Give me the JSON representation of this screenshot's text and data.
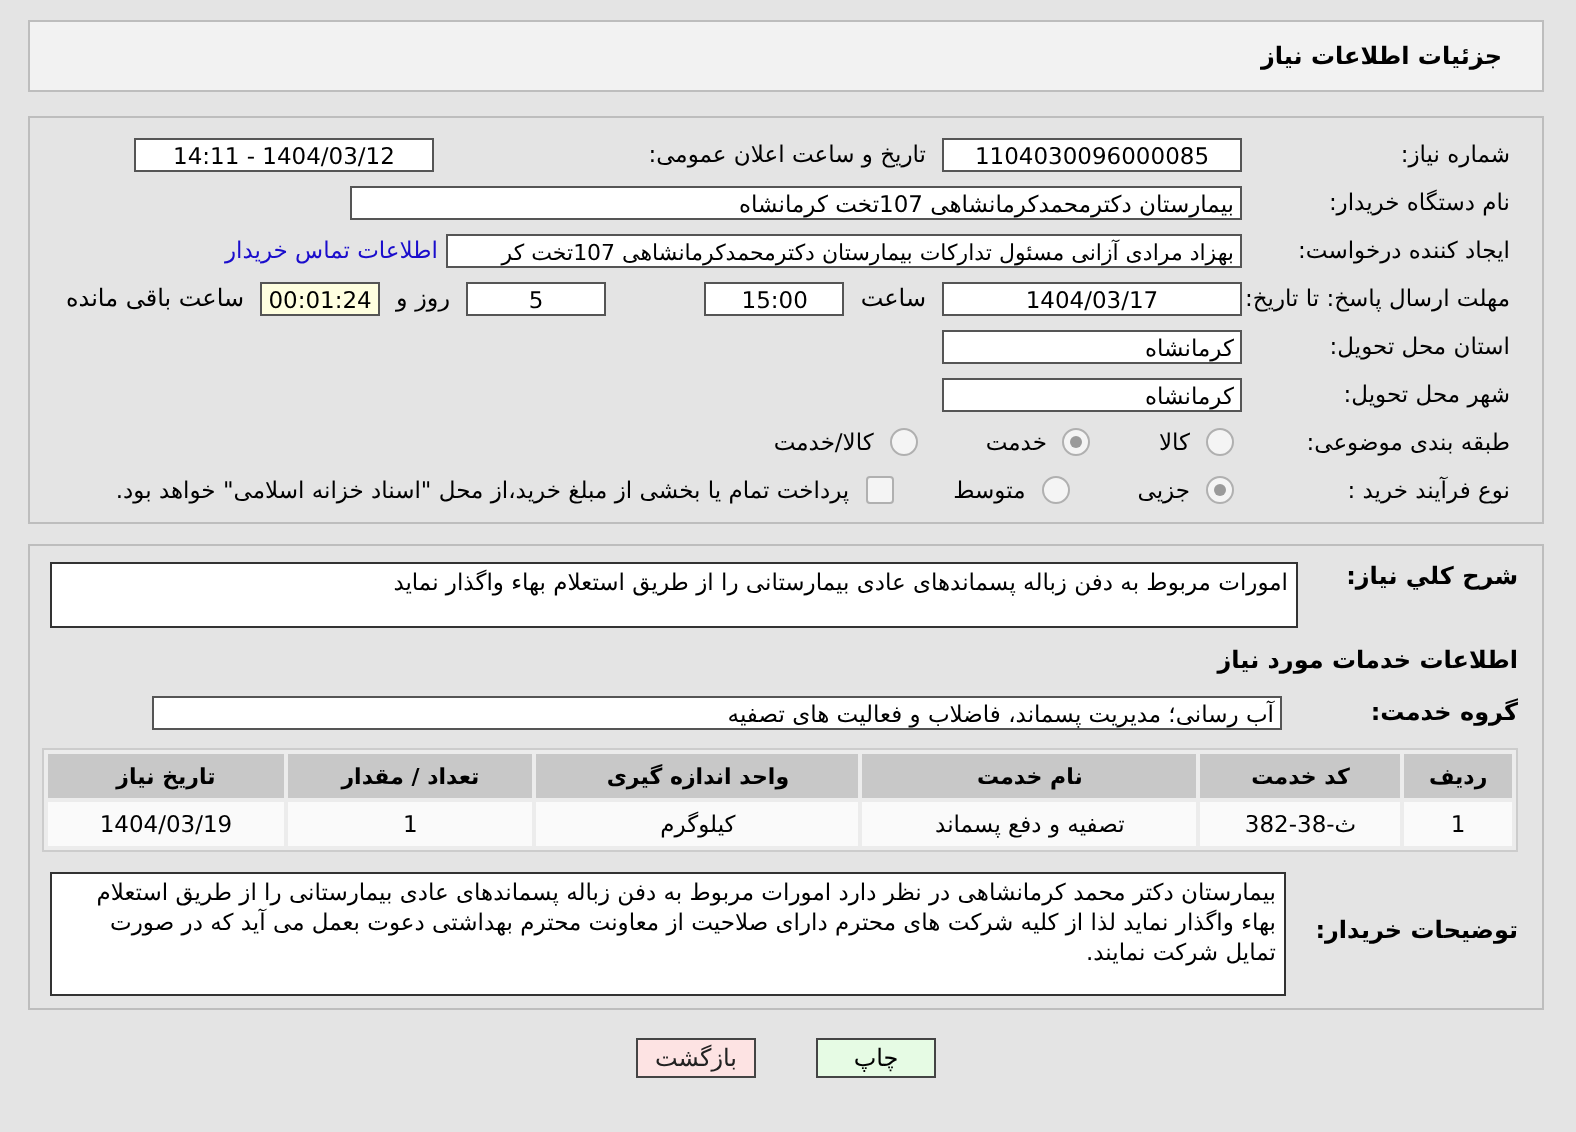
{
  "header": {
    "title": "جزئیات اطلاعات نیاز"
  },
  "fields": {
    "need_number": {
      "label": "شماره نیاز:",
      "value": "1104030096000085"
    },
    "announce": {
      "label": "تاریخ و ساعت اعلان عمومی:",
      "value": "1404/03/12 - 14:11"
    },
    "buyer_org": {
      "label": "نام دستگاه خریدار:",
      "value": "بیمارستان دکترمحمدکرمانشاهی 107تخت کرمانشاه"
    },
    "requester": {
      "label": "ایجاد کننده درخواست:",
      "value": "بهزاد مرادی آزانی مسئول تدارکات بیمارستان دکترمحمدکرمانشاهی 107تخت کر",
      "link": "اطلاعات تماس خریدار"
    },
    "deadline": {
      "label": "مهلت ارسال پاسخ: تا تاریخ:",
      "date": "1404/03/17",
      "time_label": "ساعت",
      "time": "15:00",
      "days": "5",
      "days_label": "روز و",
      "remaining": "00:01:24",
      "remaining_label": "ساعت باقی مانده"
    },
    "province": {
      "label": "استان محل تحویل:",
      "value": "کرمانشاه"
    },
    "city": {
      "label": "شهر محل تحویل:",
      "value": "کرمانشاه"
    },
    "category": {
      "label": "طبقه بندی موضوعی:",
      "options": [
        {
          "label": "کالا",
          "selected": false
        },
        {
          "label": "خدمت",
          "selected": true
        },
        {
          "label": "کالا/خدمت",
          "selected": false
        }
      ]
    },
    "purchase_type": {
      "label": "نوع فرآیند خرید :",
      "options": [
        {
          "label": "جزیی",
          "selected": true
        },
        {
          "label": "متوسط",
          "selected": false
        }
      ],
      "payment_checkbox": {
        "checked": false,
        "text": "پرداخت تمام یا بخشی از مبلغ خرید،از محل \"اسناد خزانه اسلامی\" خواهد بود."
      }
    }
  },
  "summary": {
    "label": "شرح کلي نياز:",
    "text": "امورات مربوط به دفن زباله پسماندهای عادی بیمارستانی را از طریق استعلام بهاء واگذار نماید"
  },
  "services_title": "اطلاعات خدمات مورد نیاز",
  "service_group": {
    "label": "گروه خدمت:",
    "value": "آب رسانی؛ مدیریت پسماند، فاضلاب و فعالیت های تصفیه"
  },
  "table": {
    "columns": [
      "ردیف",
      "کد خدمت",
      "نام خدمت",
      "واحد اندازه گیری",
      "تعداد / مقدار",
      "تاریخ نیاز"
    ],
    "rows": [
      [
        "1",
        "ث-38-382",
        "تصفیه و دفع پسماند",
        "کیلوگرم",
        "1",
        "1404/03/19"
      ]
    ]
  },
  "buyer_notes": {
    "label": "توضیحات خریدار:",
    "text": "بیمارستان دکتر محمد کرمانشاهی در نظر دارد امورات مربوط به دفن زباله پسماندهای عادی بیمارستانی را از طریق استعلام بهاء واگذار نماید لذا از کلیه شرکت های محترم دارای صلاحیت از معاونت محترم بهداشتی دعوت بعمل می آید که در صورت تمایل شرکت نمایند."
  },
  "buttons": [
    {
      "kind": "print",
      "label": "چاپ"
    },
    {
      "kind": "back",
      "label": "بازگشت"
    }
  ]
}
